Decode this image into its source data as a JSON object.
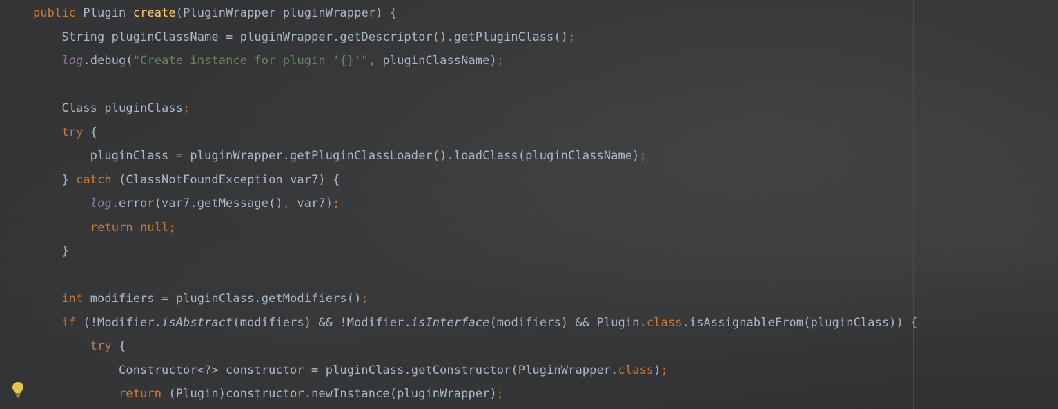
{
  "editor": {
    "lines": [
      [
        {
          "t": "public ",
          "c": "kw"
        },
        {
          "t": "Plugin "
        },
        {
          "t": "create",
          "c": "fn"
        },
        {
          "t": "(PluginWrapper pluginWrapper) {"
        }
      ],
      [
        {
          "t": "    String pluginClassName = pluginWrapper.getDescriptor().getPluginClass()"
        },
        {
          "t": ";",
          "c": "pn"
        }
      ],
      [
        {
          "t": "    "
        },
        {
          "t": "log",
          "c": "fld"
        },
        {
          "t": ".debug("
        },
        {
          "t": "\"Create instance for plugin '{}'\"",
          "c": "str"
        },
        {
          "t": ", ",
          "c": "pn"
        },
        {
          "t": "pluginClassName)"
        },
        {
          "t": ";",
          "c": "pn"
        }
      ],
      [
        {
          "t": ""
        }
      ],
      [
        {
          "t": "    Class pluginClass"
        },
        {
          "t": ";",
          "c": "pn"
        }
      ],
      [
        {
          "t": "    "
        },
        {
          "t": "try ",
          "c": "kw"
        },
        {
          "t": "{"
        }
      ],
      [
        {
          "t": "        pluginClass = pluginWrapper.getPluginClassLoader().loadClass(pluginClassName)"
        },
        {
          "t": ";",
          "c": "pn"
        }
      ],
      [
        {
          "t": "    } "
        },
        {
          "t": "catch ",
          "c": "kw"
        },
        {
          "t": "(ClassNotFoundException var7) {"
        }
      ],
      [
        {
          "t": "        "
        },
        {
          "t": "log",
          "c": "fld"
        },
        {
          "t": ".error(var7.getMessage()"
        },
        {
          "t": ", ",
          "c": "pn"
        },
        {
          "t": "var7)"
        },
        {
          "t": ";",
          "c": "pn"
        }
      ],
      [
        {
          "t": "        "
        },
        {
          "t": "return null;",
          "c": "kw"
        }
      ],
      [
        {
          "t": "    }"
        }
      ],
      [
        {
          "t": ""
        }
      ],
      [
        {
          "t": "    "
        },
        {
          "t": "int ",
          "c": "kw"
        },
        {
          "t": "modifiers = pluginClass.getModifiers()"
        },
        {
          "t": ";",
          "c": "pn"
        }
      ],
      [
        {
          "t": "    "
        },
        {
          "t": "if ",
          "c": "kw"
        },
        {
          "t": "(!Modifier."
        },
        {
          "t": "isAbstract",
          "c": "it"
        },
        {
          "t": "(modifiers) && !Modifier."
        },
        {
          "t": "isInterface",
          "c": "it"
        },
        {
          "t": "(modifiers) && Plugin."
        },
        {
          "t": "class",
          "c": "kw"
        },
        {
          "t": ".isAssignableFrom(pluginClass)) {"
        }
      ],
      [
        {
          "t": "        "
        },
        {
          "t": "try ",
          "c": "kw"
        },
        {
          "t": "{"
        }
      ],
      [
        {
          "t": "            Constructor<?> constructor = pluginClass.getConstructor(PluginWrapper."
        },
        {
          "t": "class",
          "c": "kw"
        },
        {
          "t": ")"
        },
        {
          "t": ";",
          "c": "pn"
        }
      ],
      [
        {
          "t": "            "
        },
        {
          "t": "return ",
          "c": "kw"
        },
        {
          "t": "(Plugin)constructor.newInstance(pluginWrapper)"
        },
        {
          "t": ";",
          "c": "pn"
        }
      ]
    ]
  },
  "gutter": {
    "intention_icon": "lightbulb-icon"
  },
  "colors": {
    "keyword": "#cc7832",
    "method_decl": "#ffc66d",
    "string": "#6a8759",
    "field": "#9876aa",
    "default_text": "#a9b7c6",
    "bulb": "#e8c546"
  }
}
